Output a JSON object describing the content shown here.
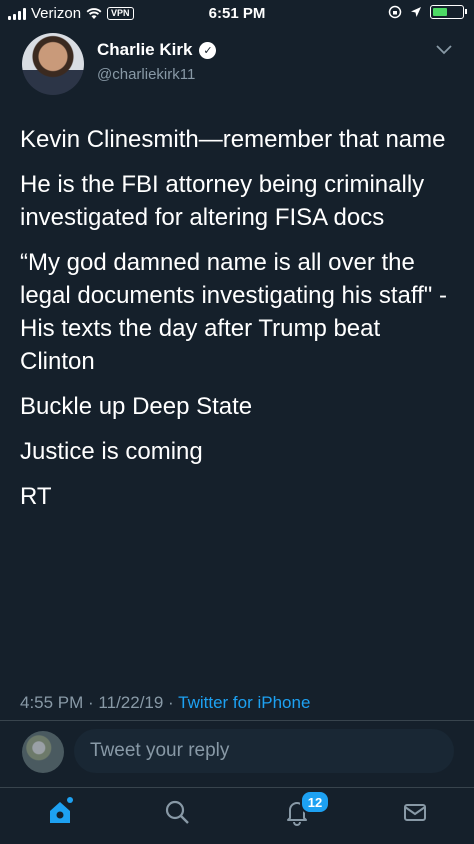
{
  "status_bar": {
    "carrier": "Verizon",
    "vpn_label": "VPN",
    "time": "6:51 PM",
    "battery_level": 0.55,
    "icons": [
      "signal-icon",
      "wifi-icon",
      "vpn-icon",
      "lock-rotation-icon",
      "location-icon",
      "battery-icon"
    ]
  },
  "tweet": {
    "author_name": "Charlie Kirk",
    "author_handle": "@charliekirk11",
    "verified": true,
    "paragraphs": [
      "Kevin Clinesmith—remember that name",
      "He is the FBI attorney being criminally investigated for altering FISA docs",
      "“My god damned name is all over the legal documents investigating his staff\" - His texts the day after Trump beat Clinton",
      "Buckle up Deep State",
      "Justice is coming",
      "RT"
    ],
    "timestamp": "4:55 PM · 11/22/19 ·",
    "source": "Twitter for iPhone"
  },
  "reply": {
    "placeholder": "Tweet your reply"
  },
  "tab_bar": {
    "tabs": [
      "home-icon",
      "search-icon",
      "notifications-icon",
      "messages-icon"
    ],
    "notification_count": "12"
  },
  "colors": {
    "background": "#15202b",
    "accent": "#1da1f2",
    "secondary_text": "#8899a6",
    "divider": "#38444d"
  }
}
